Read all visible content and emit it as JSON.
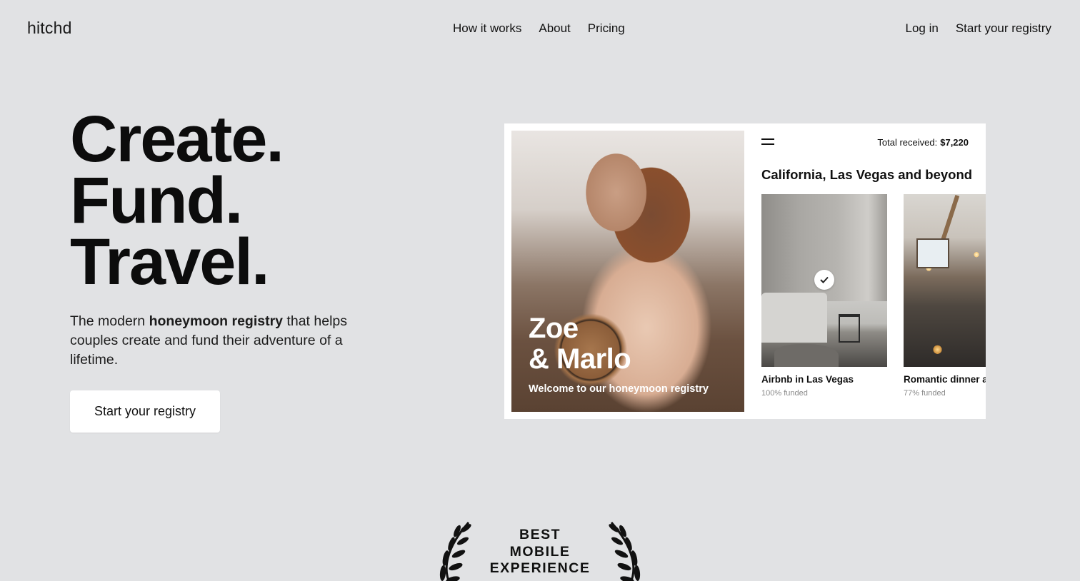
{
  "header": {
    "logo": "hitchd",
    "nav": [
      "How it works",
      "About",
      "Pricing"
    ],
    "login": "Log in",
    "start_registry": "Start your registry"
  },
  "hero": {
    "headline": [
      "Create.",
      "Fund.",
      "Travel."
    ],
    "sub_prefix": "The modern ",
    "sub_bold": "honeymoon registry",
    "sub_suffix": " that helps couples create and fund their adventure of a lifetime.",
    "cta": "Start your registry"
  },
  "mock": {
    "names_line1": "Zoe",
    "names_line2": "& Marlo",
    "welcome": "Welcome to our honeymoon registry",
    "total_label": "Total received:",
    "total_value": "$7,220",
    "title": "California, Las Vegas and beyond",
    "items": [
      {
        "title": "Airbnb in Las Vegas",
        "funded": "100% funded",
        "funded_percent": 100,
        "icon": "check-icon"
      },
      {
        "title": "Romantic dinner at",
        "funded": "77% funded",
        "funded_percent": 77
      }
    ]
  },
  "award": {
    "line1": "BEST",
    "line2": "MOBILE",
    "line3": "EXPERIENCE"
  }
}
